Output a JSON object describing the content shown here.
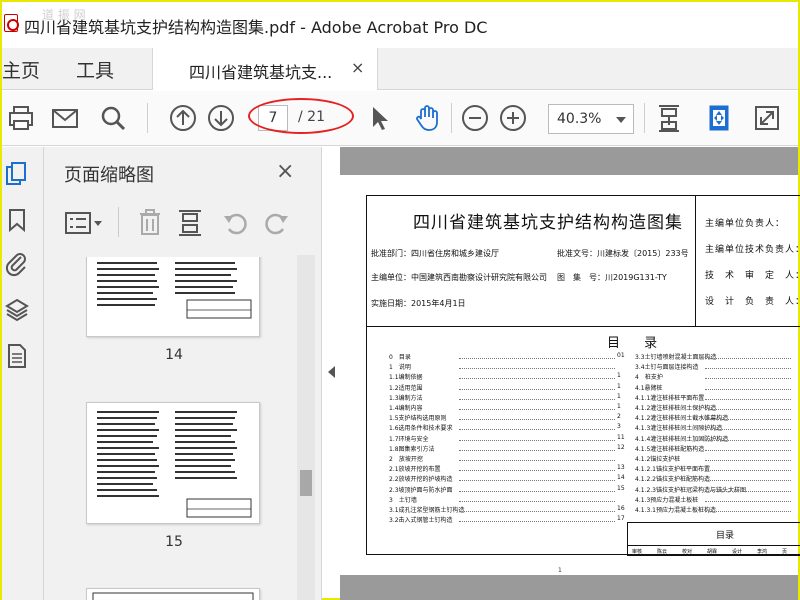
{
  "window": {
    "title": "四川省建筑基坑支护结构构造图集.pdf - Adobe Acrobat Pro DC",
    "watermark": "道 振 网"
  },
  "menu": {
    "home": "主页",
    "tools": "工具"
  },
  "tab": {
    "label": "四川省建筑基坑支...",
    "close": "×"
  },
  "toolbar": {
    "page_current": "7",
    "page_total": "/ 21",
    "zoom": "40.3%",
    "icons": [
      "print-icon",
      "email-icon",
      "search-icon",
      "page-up-icon",
      "page-down-icon",
      "select-cursor-icon",
      "hand-tool-icon",
      "zoom-out-icon",
      "zoom-in-icon",
      "scroll-mode-icon",
      "fit-page-icon",
      "fullscreen-icon"
    ]
  },
  "sidebar": {
    "icons": [
      "page-thumbnails-icon",
      "bookmarks-icon",
      "attachments-icon",
      "layers-icon",
      "document-icon"
    ]
  },
  "panel": {
    "title": "页面缩略图",
    "close": "×",
    "thumbnails": [
      {
        "label": "14"
      },
      {
        "label": "15"
      }
    ]
  },
  "document": {
    "title": "四川省建筑基坑支护结构构造图集",
    "approval_dept": "批准部门：四川省住房和城乡建设厅",
    "approval_no": "批准文号：川建标发〔2015〕233号",
    "editor_unit": "主编单位：中国建筑西南勘察设计研究院有限公司",
    "atlas_no": "图　集　号：川2019G131-TY",
    "impl_date": "实施日期：2015年4月1日",
    "right_labels": [
      "主编单位负责人：",
      "主编单位技术负责人：",
      "技　术　审　定　人：",
      "设　计　负　责　人："
    ],
    "toc_title": "目 录",
    "toc_left": [
      {
        "t": "0　目录",
        "n": "01"
      },
      {
        "t": "1　说明",
        "n": ""
      },
      {
        "t": "1.1编制依据",
        "n": "1"
      },
      {
        "t": "1.2适用范围",
        "n": "1"
      },
      {
        "t": "1.3编制方法",
        "n": "1"
      },
      {
        "t": "1.4编制内容",
        "n": "1"
      },
      {
        "t": "1.5支护结构选用原则",
        "n": "2"
      },
      {
        "t": "1.6选用条件和技术要求",
        "n": "3"
      },
      {
        "t": "1.7环境与安全",
        "n": "11"
      },
      {
        "t": "1.8图集索引方法",
        "n": "12"
      },
      {
        "t": "2　放坡开挖",
        "n": ""
      },
      {
        "t": "2.1放坡开挖的布置",
        "n": "13"
      },
      {
        "t": "2.2放坡开挖的护坡构造",
        "n": "14"
      },
      {
        "t": "2.3坡顶护面与防水护面",
        "n": "15"
      },
      {
        "t": "3　土钉墙",
        "n": ""
      },
      {
        "t": "3.1成孔注浆型钢筋土钉构造",
        "n": "16"
      },
      {
        "t": "3.2击入式钢管土钉构造",
        "n": "17"
      }
    ],
    "toc_right": [
      {
        "t": "3.3土钉墙喷射混凝土面层构造",
        "n": ""
      },
      {
        "t": "3.4土钉与面层连接构造",
        "n": ""
      },
      {
        "t": "4　桩支护",
        "n": ""
      },
      {
        "t": "4.1悬臂桩",
        "n": ""
      },
      {
        "t": "4.1.1灌注桩排桩平面布置",
        "n": ""
      },
      {
        "t": "4.1.2灌注桩排桩间土保护构造",
        "n": ""
      },
      {
        "t": "4.1.2灌注桩排桩间土截水帷幕构造",
        "n": ""
      },
      {
        "t": "4.1.3灌注桩排桩间土间隙护构造",
        "n": ""
      },
      {
        "t": "4.1.4灌注桩排桩间土加固防护构造",
        "n": ""
      },
      {
        "t": "4.1.5灌注桩排桩配筋构造",
        "n": ""
      },
      {
        "t": "4.1.2锚拉支护桩",
        "n": ""
      },
      {
        "t": "4.1.2.1锚拉支护桩平面布置",
        "n": ""
      },
      {
        "t": "4.1.2.2锚拉支护桩配筋构造",
        "n": ""
      },
      {
        "t": "4.1.2.3锚拉支护桩冠梁构造与锚头大样图",
        "n": ""
      },
      {
        "t": "4.1.3预应力混凝土板桩",
        "n": ""
      },
      {
        "t": "4.1.3.1预应力混凝土板桩构造",
        "n": ""
      }
    ],
    "stamp_title": "目录",
    "stamp_row": [
      "审核",
      "陈云",
      "校对",
      "胡霖",
      "设计",
      "李鸿",
      "页"
    ],
    "page_num": "1"
  }
}
